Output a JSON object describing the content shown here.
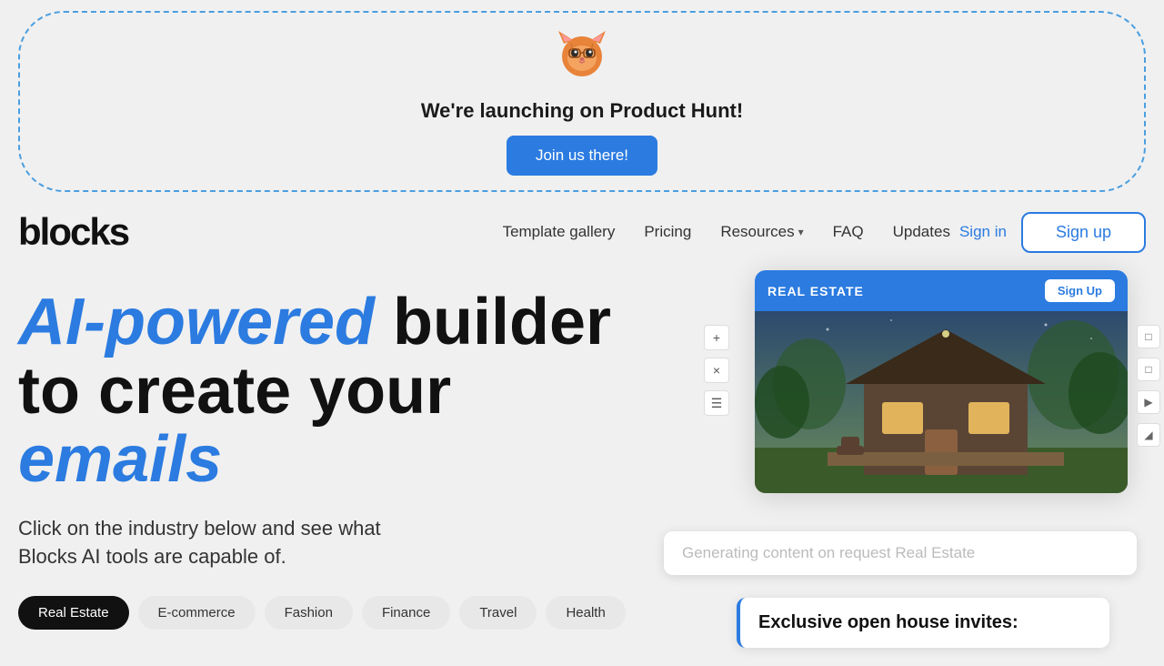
{
  "banner": {
    "title": "We're launching on Product Hunt!",
    "button_label": "Join us there!",
    "cat_emoji": "🐱"
  },
  "nav": {
    "logo": "blocks",
    "links": [
      {
        "label": "Template gallery",
        "id": "template-gallery",
        "active": false
      },
      {
        "label": "Pricing",
        "id": "pricing",
        "active": false
      },
      {
        "label": "Resources",
        "id": "resources",
        "active": false,
        "dropdown": true
      },
      {
        "label": "FAQ",
        "id": "faq",
        "active": false
      },
      {
        "label": "Updates",
        "id": "updates",
        "active": false
      }
    ],
    "signin_label": "Sign in",
    "signup_label": "Sign up"
  },
  "hero": {
    "line1_blue": "AI-powered",
    "line1_rest": " builder",
    "line2": "to create your",
    "line3_blue_italic": "emails",
    "subtitle_line1": "Click on the industry below and see what",
    "subtitle_line2": "Blocks AI tools are capable of.",
    "pills": [
      {
        "label": "Real Estate",
        "active": true
      },
      {
        "label": "E-commerce",
        "active": false
      },
      {
        "label": "Fashion",
        "active": false
      },
      {
        "label": "Finance",
        "active": false
      },
      {
        "label": "Travel",
        "active": false
      },
      {
        "label": "Health",
        "active": false
      }
    ]
  },
  "email_preview": {
    "header_title": "REAL ESTATE",
    "header_btn": "Sign Up",
    "generating_text": "Generating content on request Real Estate",
    "exclusive_text": "Exclusive open house invites:"
  },
  "builder_controls": [
    "+",
    "×",
    "☰"
  ],
  "right_icons": [
    "□",
    "□",
    "▶",
    "◢"
  ]
}
